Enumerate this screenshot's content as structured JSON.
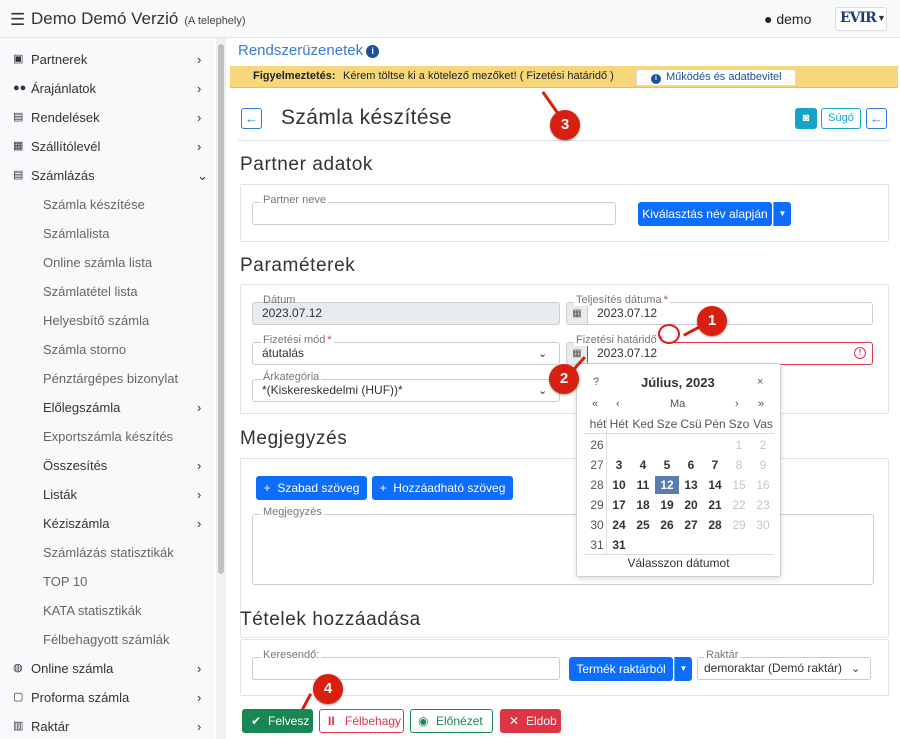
{
  "topbar": {
    "menu_icon": "hamburger-icon",
    "app_title": "Demo Demó Verzió",
    "app_subtitle": "(A telephely)",
    "user_name": "demo",
    "logo_text": "EVIR"
  },
  "sidebar": {
    "items": [
      {
        "label": "Partnerek",
        "icon": "partners-icon"
      },
      {
        "label": "Árajánlatok",
        "icon": "quotes-icon"
      },
      {
        "label": "Rendelések",
        "icon": "orders-icon"
      },
      {
        "label": "Szállítólevél",
        "icon": "delivery-icon"
      },
      {
        "label": "Számlázás",
        "icon": "invoicing-icon"
      },
      {
        "label": "Számla készítése"
      },
      {
        "label": "Számlalista"
      },
      {
        "label": "Online számla lista"
      },
      {
        "label": "Számlatétel lista"
      },
      {
        "label": "Helyesbítő számla"
      },
      {
        "label": "Számla storno"
      },
      {
        "label": "Pénztárgépes bizonylat"
      },
      {
        "label": "Előlegszámla"
      },
      {
        "label": "Exportszámla készítés"
      },
      {
        "label": "Összesítés"
      },
      {
        "label": "Listák"
      },
      {
        "label": "Kéziszámla"
      },
      {
        "label": "Számlázás statisztikák"
      },
      {
        "label": "TOP 10"
      },
      {
        "label": "KATA statisztikák"
      },
      {
        "label": "Félbehagyott számlák"
      },
      {
        "label": "Online számla",
        "icon": "globe-icon"
      },
      {
        "label": "Proforma számla",
        "icon": "proforma-icon"
      },
      {
        "label": "Raktár",
        "icon": "warehouse-icon"
      }
    ]
  },
  "system": {
    "heading": "Rendszerüzenetek",
    "warning_label": "Figyelmeztetés:",
    "warning_message": "Kérem töltse ki a kötelező mezőket! ( Fizetési határidő )",
    "help_link": "Működés és adatbevitel"
  },
  "page": {
    "title": "Számla készítése",
    "help_button": "Súgó"
  },
  "partner": {
    "section_title": "Partner adatok",
    "name_label": "Partner neve",
    "name_value": "",
    "select_button": "Kiválasztás név alapján"
  },
  "params": {
    "section_title": "Paraméterek",
    "date_label": "Dátum",
    "date_value": "2023.07.12",
    "fulfilment_label": "Teljesítés dátuma",
    "fulfilment_value": "2023.07.12",
    "payment_method_label": "Fizetési mód",
    "payment_method_value": "átutalás",
    "due_date_label": "Fizetési határidő",
    "due_date_value": "2023.07.12",
    "price_category_label": "Árkategória",
    "price_category_value": "*(Kiskereskedelmi (HUF))*",
    "required_mark": "*"
  },
  "calendar": {
    "help": "?",
    "month_title": "Július, 2023",
    "close": "×",
    "prev_year": "«",
    "prev_month": "‹",
    "today_label": "Ma",
    "next_month": "›",
    "next_year": "»",
    "headers": [
      "hét",
      "Hét",
      "Ked",
      "Sze",
      "Csü",
      "Pén",
      "Szo",
      "Vas"
    ],
    "weeks": [
      {
        "wk": "26",
        "days": [
          "",
          "",
          "",
          "",
          "",
          "1",
          "2"
        ]
      },
      {
        "wk": "27",
        "days": [
          "3",
          "4",
          "5",
          "6",
          "7",
          "8",
          "9"
        ]
      },
      {
        "wk": "28",
        "days": [
          "10",
          "11",
          "12",
          "13",
          "14",
          "15",
          "16"
        ]
      },
      {
        "wk": "29",
        "days": [
          "17",
          "18",
          "19",
          "20",
          "21",
          "22",
          "23"
        ]
      },
      {
        "wk": "30",
        "days": [
          "24",
          "25",
          "26",
          "27",
          "28",
          "29",
          "30"
        ]
      },
      {
        "wk": "31",
        "days": [
          "31",
          "",
          "",
          "",
          "",
          "",
          ""
        ]
      }
    ],
    "selected_day": "12",
    "footer": "Válasszon dátumot"
  },
  "notes": {
    "section_title": "Megjegyzés",
    "free_text_button": "Szabad szöveg",
    "addable_text_button": "Hozzáadható szöveg",
    "textarea_label": "Megjegyzés",
    "textarea_value": ""
  },
  "items": {
    "section_title": "Tételek hozzáadása",
    "search_label": "Keresendő:",
    "search_value": "",
    "product_button": "Termék raktárból",
    "warehouse_label": "Raktár",
    "warehouse_value": "demoraktar (Demó raktár)"
  },
  "actions": {
    "save": "Felvesz",
    "pause": "Félbehagy",
    "preview": "Előnézet",
    "discard": "Eldob"
  },
  "annotations": {
    "badge1": "1",
    "badge2": "2",
    "badge3": "3",
    "badge4": "4"
  },
  "colors": {
    "primary": "#0d6efd",
    "warning_bg": "#f8d77a",
    "annotation_red": "#d81f10",
    "success": "#198754",
    "danger": "#dc3545"
  }
}
